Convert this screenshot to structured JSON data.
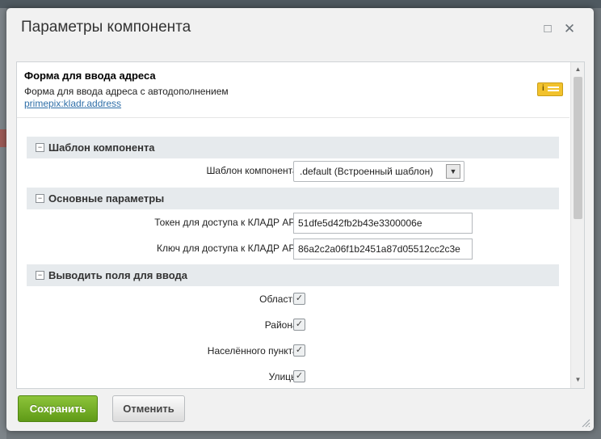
{
  "dialog": {
    "title": "Параметры компонента",
    "maximize_icon": "□",
    "close_icon": "✕"
  },
  "component": {
    "name": "Форма для ввода адреса",
    "description": "Форма для ввода адреса с автодополнением",
    "code": "primepix:kladr.address"
  },
  "sections": {
    "template": {
      "title": "Шаблон компонента",
      "template_label": "Шаблон компонента:",
      "template_value": ".default (Встроенный шаблон)"
    },
    "main": {
      "title": "Основные параметры",
      "token_label": "Токен для доступа к КЛАДР API:",
      "token_value": "51dfe5d42fb2b43e3300006e",
      "key_label": "Ключ для доступа к КЛАДР API:",
      "key_value": "86a2c2a06f1b2451a87d05512cc2c3e"
    },
    "fields": {
      "title": "Выводить поля для ввода",
      "items": [
        {
          "label": "Области:",
          "checked": true
        },
        {
          "label": "Района:",
          "checked": true
        },
        {
          "label": "Населённого пункта:",
          "checked": true
        },
        {
          "label": "Улицы:",
          "checked": true
        }
      ]
    }
  },
  "buttons": {
    "save": "Сохранить",
    "cancel": "Отменить"
  },
  "colors": {
    "save_button": "#6fa823",
    "section_bg": "#e6eaed",
    "link": "#2f6fa8"
  }
}
